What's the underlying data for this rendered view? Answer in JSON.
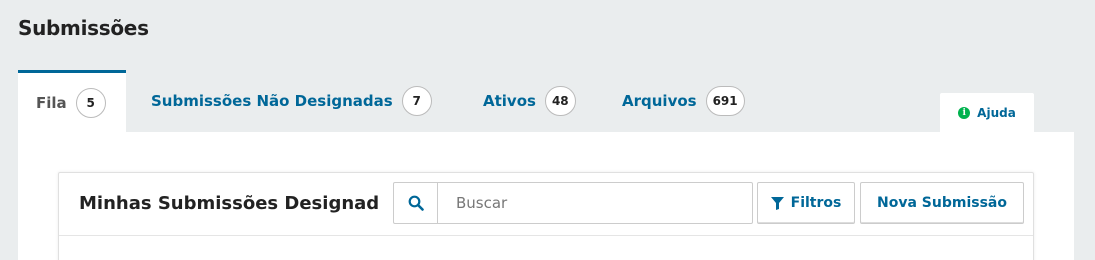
{
  "page": {
    "title": "Submissões"
  },
  "tabs": [
    {
      "label": "Fila",
      "count": "5",
      "active": true
    },
    {
      "label": "Submissões Não Designadas",
      "count": "7",
      "active": false
    },
    {
      "label": "Ativos",
      "count": "48",
      "active": false
    },
    {
      "label": "Arquivos",
      "count": "691",
      "active": false
    }
  ],
  "help": {
    "label": "Ajuda",
    "icon": "info-icon"
  },
  "list_panel": {
    "title": "Minhas Submissões Designadas",
    "search": {
      "value": "",
      "placeholder": "Buscar",
      "icon": "search-icon"
    },
    "filters_label": "Filtros",
    "filters_icon": "filter-icon",
    "new_submission_label": "Nova Submissão"
  },
  "colors": {
    "primary": "#006798",
    "background": "#eaedee",
    "help_icon": "#00b24e"
  }
}
